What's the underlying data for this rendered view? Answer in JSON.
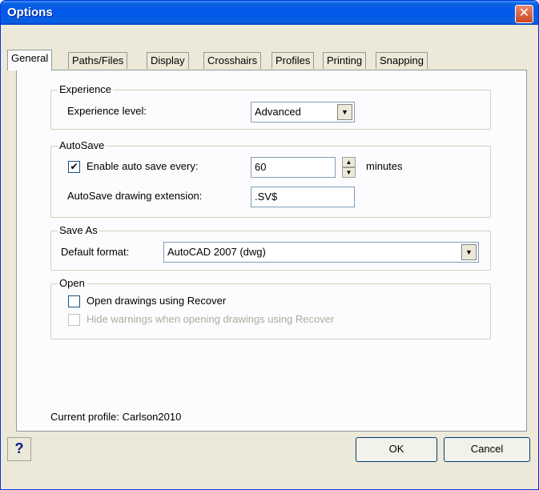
{
  "window": {
    "title": "Options",
    "close_glyph": "✕"
  },
  "tabs": [
    {
      "label": "General"
    },
    {
      "label": "Paths/Files"
    },
    {
      "label": "Display"
    },
    {
      "label": "Crosshairs"
    },
    {
      "label": "Profiles"
    },
    {
      "label": "Printing"
    },
    {
      "label": "Snapping"
    }
  ],
  "experience": {
    "group_label": "Experience",
    "level_label": "Experience level:",
    "level_value": "Advanced"
  },
  "autosave": {
    "group_label": "AutoSave",
    "enable_label": "Enable auto save every:",
    "enabled": true,
    "interval_value": "60",
    "units_label": "minutes",
    "extension_label": "AutoSave drawing extension:",
    "extension_value": ".SV$"
  },
  "save_as": {
    "group_label": "Save As",
    "format_label": "Default format:",
    "format_value": "AutoCAD 2007 (dwg)"
  },
  "open": {
    "group_label": "Open",
    "recover_label": "Open drawings using Recover",
    "recover_checked": false,
    "hide_warnings_label": "Hide warnings when opening drawings using Recover",
    "hide_warnings_checked": false
  },
  "profile": {
    "label": "Current profile:",
    "value": "Carlson2010"
  },
  "buttons": {
    "help": "?",
    "ok": "OK",
    "cancel": "Cancel"
  },
  "glyphs": {
    "check_mark": "✔",
    "dropdown": "▼",
    "spin_up": "▲",
    "spin_down": "▼"
  }
}
